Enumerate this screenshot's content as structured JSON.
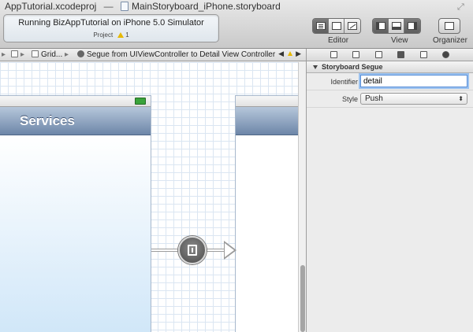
{
  "window": {
    "project_file": "AppTutorial.xcodeproj",
    "separator": "—",
    "storyboard_file": "MainStoryboard_iPhone.storyboard"
  },
  "activity": {
    "status": "Running BizAppTutorial on iPhone 5.0 Simulator",
    "project_label": "Project",
    "warning_count": "1"
  },
  "toolbar": {
    "editor_label": "Editor",
    "view_label": "View",
    "organizer_label": "Organizer"
  },
  "jumpbar": {
    "grid_label": "Grid...",
    "segue_label": "Segue from UIViewController to Detail View Controller"
  },
  "canvas": {
    "scene1_title": "Services"
  },
  "inspector": {
    "section_title": "Storyboard Segue",
    "identifier_label": "Identifier",
    "identifier_value": "detail",
    "style_label": "Style",
    "style_value": "Push"
  }
}
